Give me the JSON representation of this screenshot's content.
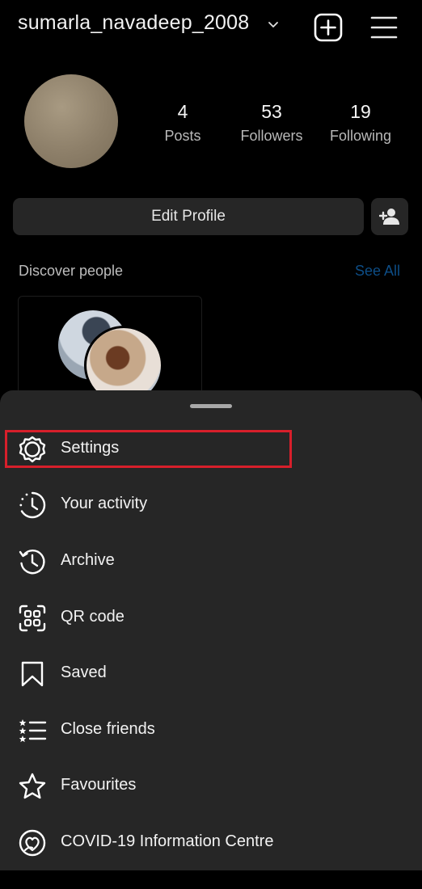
{
  "header": {
    "username": "sumarla_navadeep_2008"
  },
  "profile": {
    "stats": [
      {
        "value": "4",
        "label": "Posts"
      },
      {
        "value": "53",
        "label": "Followers"
      },
      {
        "value": "19",
        "label": "Following"
      }
    ],
    "edit_profile_label": "Edit Profile"
  },
  "discover": {
    "title": "Discover people",
    "see_all_label": "See All"
  },
  "menu": {
    "items": [
      {
        "label": "Settings",
        "icon": "gear-icon"
      },
      {
        "label": "Your activity",
        "icon": "activity-clock-icon"
      },
      {
        "label": "Archive",
        "icon": "archive-icon"
      },
      {
        "label": "QR code",
        "icon": "qr-code-icon"
      },
      {
        "label": "Saved",
        "icon": "bookmark-icon"
      },
      {
        "label": "Close friends",
        "icon": "close-friends-icon"
      },
      {
        "label": "Favourites",
        "icon": "star-icon"
      },
      {
        "label": "COVID-19 Information Centre",
        "icon": "covid-info-icon"
      }
    ]
  },
  "colors": {
    "background": "#000000",
    "sheet": "#262626",
    "link_blue": "#0d4d86",
    "highlight_red": "#d71f2b"
  }
}
